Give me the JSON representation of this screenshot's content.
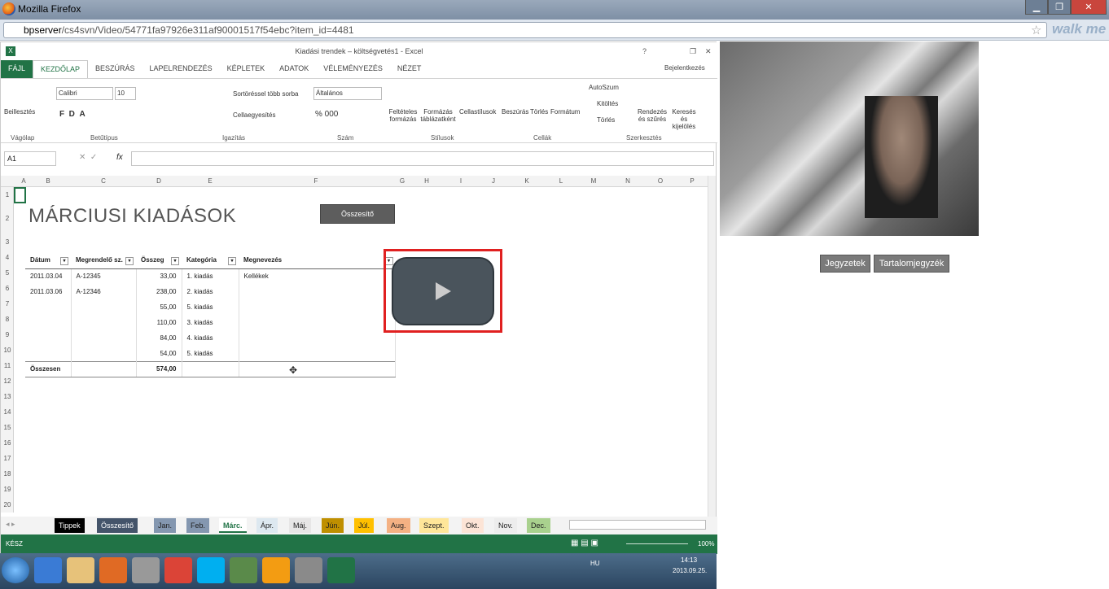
{
  "browser": {
    "title": "Mozilla Firefox",
    "url_host": "bpserver",
    "url_path": "/cs4svn/Video/54771fa97926e311af90001517f54ebc?item_id=4481",
    "walkme": "walk me"
  },
  "excel": {
    "title": "Kiadási trendek – költségvetés1 - Excel",
    "signin": "Bejelentkezés",
    "tabs": [
      "FÁJL",
      "KEZDŐLAP",
      "BESZÚRÁS",
      "LAPELRENDEZÉS",
      "KÉPLETEK",
      "ADATOK",
      "VÉLEMÉNYEZÉS",
      "NÉZET"
    ],
    "ribbon": {
      "paste": "Beillesztés",
      "clipboard": "Vágólap",
      "font_name": "Calibri",
      "font_size": "10",
      "font_group": "Betűtípus",
      "wrap": "Sortöréssel több sorba",
      "merge": "Cellaegyesítés",
      "align_group": "Igazítás",
      "number_format": "Általános",
      "number_group": "Szám",
      "cond": "Feltételes formázás",
      "fmt_table": "Formázás táblázatként",
      "cell_styles": "Cellastílusok",
      "styles_group": "Stílusok",
      "insert": "Beszúrás",
      "delete": "Törlés",
      "format": "Formátum",
      "cells_group": "Cellák",
      "autosum": "AutoSzum",
      "fill": "Kitöltés",
      "clear": "Törlés",
      "sort": "Rendezés és szűrés",
      "find": "Keresés és kijelölés",
      "edit_group": "Szerkesztés"
    },
    "name_box": "A1",
    "fx": "fx",
    "columns": [
      "A",
      "B",
      "C",
      "D",
      "E",
      "F",
      "G",
      "H",
      "I",
      "J",
      "K",
      "L",
      "M",
      "N",
      "O",
      "P"
    ],
    "rows": [
      "1",
      "2",
      "3",
      "4",
      "5",
      "6",
      "7",
      "8",
      "9",
      "10",
      "11",
      "12",
      "13",
      "14",
      "15",
      "16",
      "17",
      "18",
      "19",
      "20"
    ],
    "sheet_title": "MÁRCIUSI KIADÁSOK",
    "summary_button": "Összesítő",
    "table": {
      "headers": [
        "Dátum",
        "Megrendelő sz.",
        "Összeg",
        "Kategória",
        "Megnevezés"
      ],
      "rows": [
        [
          "2011.03.04",
          "A-12345",
          "33,00",
          "1. kiadás",
          "Kellékek"
        ],
        [
          "2011.03.06",
          "A-12346",
          "238,00",
          "2. kiadás",
          ""
        ],
        [
          "",
          "",
          "55,00",
          "5. kiadás",
          ""
        ],
        [
          "",
          "",
          "110,00",
          "3. kiadás",
          ""
        ],
        [
          "",
          "",
          "84,00",
          "4. kiadás",
          ""
        ],
        [
          "",
          "",
          "54,00",
          "5. kiadás",
          ""
        ]
      ],
      "total_label": "Összesen",
      "total_value": "574,00"
    },
    "sheet_tabs": [
      "Tippek",
      "Összesítő",
      "Jan.",
      "Feb.",
      "Márc.",
      "Ápr.",
      "Máj.",
      "Jún.",
      "Júl.",
      "Aug.",
      "Szept.",
      "Okt.",
      "Nov.",
      "Dec."
    ],
    "status": "KÉSZ",
    "zoom": "100%"
  },
  "side": {
    "notes": "Jegyzetek",
    "toc": "Tartalomjegyzék"
  },
  "taskbar": {
    "lang": "HU",
    "time": "14:13",
    "date": "2013.09.25."
  }
}
